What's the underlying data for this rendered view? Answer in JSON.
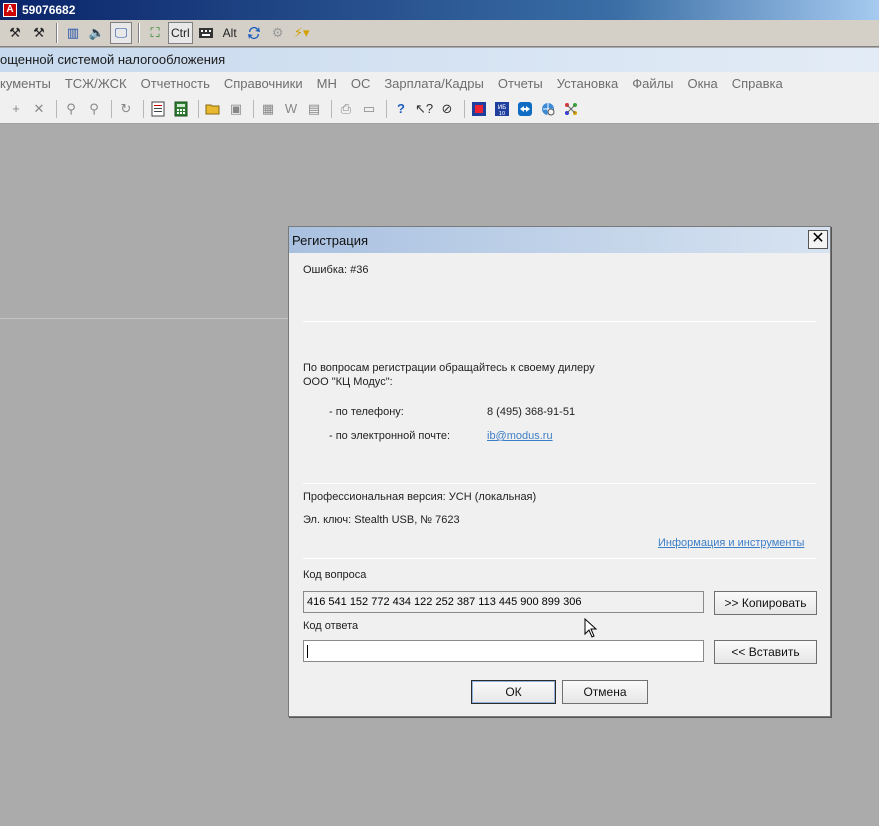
{
  "remote": {
    "title": "59076682",
    "toolbar": [
      {
        "name": "tools-icon",
        "glyph": "⚒"
      },
      {
        "name": "tools-alt-icon",
        "glyph": "⚒"
      },
      {
        "name": "columns-icon",
        "glyph": "▥"
      },
      {
        "name": "speaker-icon",
        "glyph": "🔈"
      },
      {
        "name": "monitor-icon",
        "glyph": "🖵"
      },
      {
        "name": "fullscreen-icon",
        "glyph": "⛶"
      }
    ],
    "ctrl_label": "Ctrl",
    "alt_label": "Alt"
  },
  "app": {
    "title": "ощенной системой налогообложения"
  },
  "menu": [
    "кументы",
    "ТСЖ/ЖСК",
    "Отчетность",
    "Справочники",
    "МН",
    "ОС",
    "Зарплата/Кадры",
    "Отчеты",
    "Установка",
    "Файлы",
    "Окна",
    "Справка"
  ],
  "dialog": {
    "title": "Регистрация",
    "close_glyph": "✕",
    "error": "Ошибка: #36",
    "contact_line1": "По вопросам регистрации обращайтесь к своему дилеру",
    "contact_line2": "ООО \"КЦ Модус\":",
    "phone_label": "- по телефону:",
    "phone_value": "8 (495) 368-91-51",
    "email_label": "- по электронной почте:",
    "email_value": "ib@modus.ru",
    "version": "Профессиональная версия: УСН (локальная)",
    "key": "Эл. ключ: Stealth USB, № 7623",
    "info_link": "Информация и инструменты",
    "question_label": "Код вопроса",
    "question_value": "416 541 152 772 434 122 252 387 113 445 900 899 306",
    "copy_button": ">> Копировать",
    "answer_label": "Код ответа",
    "answer_value": "",
    "paste_button": "<< Вставить",
    "ok_button": "ОК",
    "cancel_button": "Отмена"
  }
}
